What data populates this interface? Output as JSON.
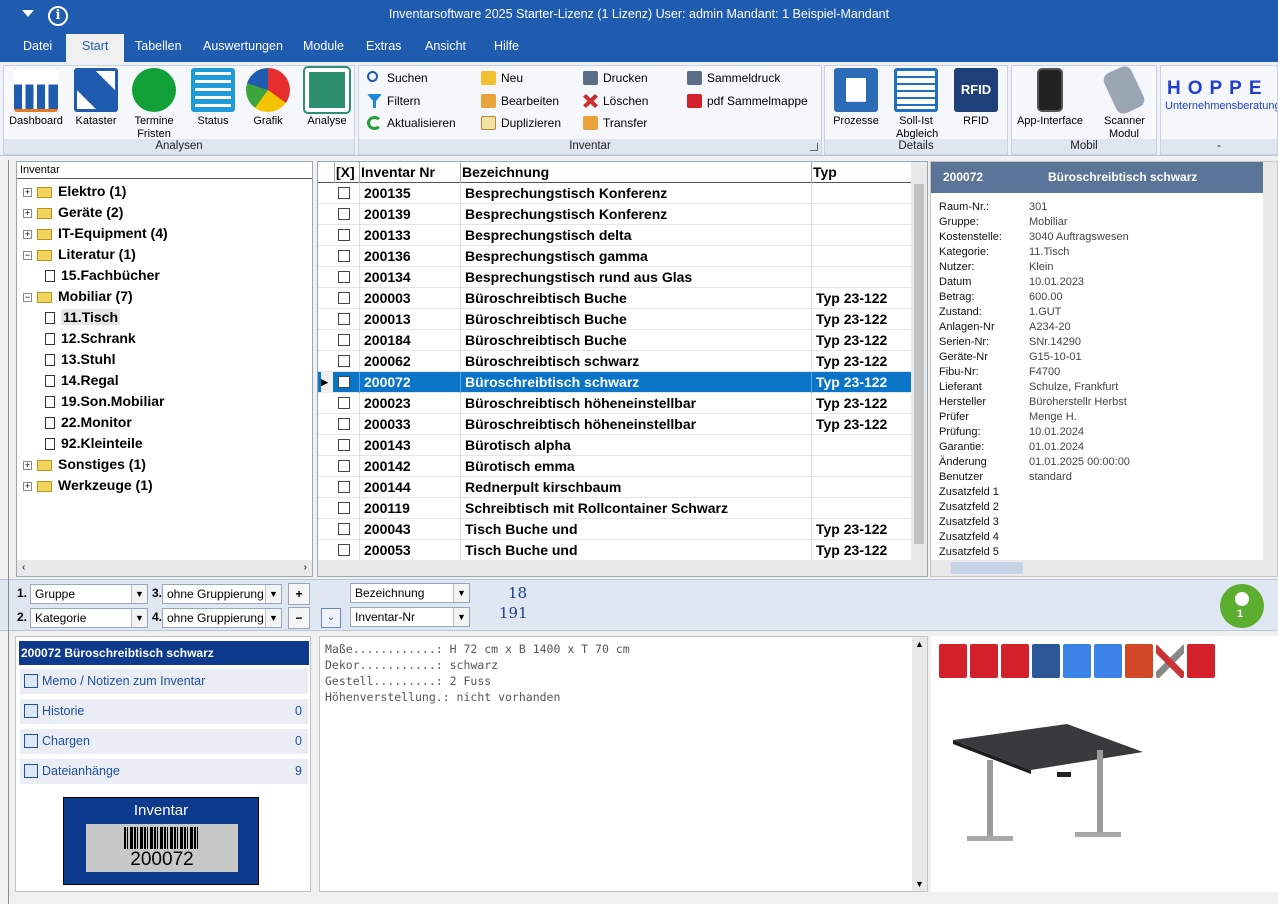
{
  "window": {
    "title": "Inventarsoftware 2025 Starter-Lizenz (1 Lizenz)   User: admin   Mandant: 1 Beispiel-Mandant"
  },
  "menu": [
    "Datei",
    "Start",
    "Tabellen",
    "Auswertungen",
    "Module",
    "Extras",
    "Ansicht",
    "Hilfe"
  ],
  "ribbon": {
    "analysen": {
      "label": "Analysen",
      "buttons": [
        "Dashboard",
        "Kataster",
        "Termine Fristen",
        "Status",
        "Grafik",
        "Analyse"
      ]
    },
    "inventar": {
      "label": "Inventar",
      "col1": [
        "Suchen",
        "Filtern",
        "Aktualisieren"
      ],
      "col2": [
        "Neu",
        "Bearbeiten",
        "Duplizieren"
      ],
      "col3": [
        "Drucken",
        "Löschen",
        "Transfer"
      ],
      "col4": [
        "Sammeldruck",
        "pdf Sammelmappe"
      ]
    },
    "details": {
      "label": "Details",
      "buttons": [
        "Prozesse",
        "Soll-Ist Abgleich",
        "RFID"
      ]
    },
    "mobil": {
      "label": "Mobil",
      "buttons": [
        "App-Interface",
        "Scanner Modul"
      ]
    },
    "extra": {
      "label": "-",
      "logo_line1": "HOPPE",
      "logo_line2": "Unternehmensberatung"
    }
  },
  "tree": {
    "header": "Inventar",
    "items": [
      {
        "label": "Elektro  (1)",
        "level": 0,
        "type": "folder",
        "sign": "+"
      },
      {
        "label": "Geräte  (2)",
        "level": 0,
        "type": "folder",
        "sign": "+"
      },
      {
        "label": "IT-Equipment  (4)",
        "level": 0,
        "type": "folder",
        "sign": "+"
      },
      {
        "label": "Literatur  (1)",
        "level": 0,
        "type": "folder",
        "sign": "−"
      },
      {
        "label": "15.Fachbücher",
        "level": 1,
        "type": "leaf"
      },
      {
        "label": "Mobiliar  (7)",
        "level": 0,
        "type": "folder",
        "sign": "−"
      },
      {
        "label": "11.Tisch",
        "level": 1,
        "type": "leaf",
        "selected": true
      },
      {
        "label": "12.Schrank",
        "level": 1,
        "type": "leaf"
      },
      {
        "label": "13.Stuhl",
        "level": 1,
        "type": "leaf"
      },
      {
        "label": "14.Regal",
        "level": 1,
        "type": "leaf"
      },
      {
        "label": "19.Son.Mobiliar",
        "level": 1,
        "type": "leaf"
      },
      {
        "label": "22.Monitor",
        "level": 1,
        "type": "leaf"
      },
      {
        "label": "92.Kleinteile",
        "level": 1,
        "type": "leaf"
      },
      {
        "label": "Sonstiges  (1)",
        "level": 0,
        "type": "folder",
        "sign": "+"
      },
      {
        "label": "Werkzeuge  (1)",
        "level": 0,
        "type": "folder",
        "sign": "+"
      }
    ]
  },
  "grid": {
    "headers": {
      "check": "[X]",
      "nr": "Inventar Nr",
      "bez": "Bezeichnung",
      "typ": "Typ"
    },
    "rows": [
      {
        "nr": "200135",
        "bez": "Besprechungstisch Konferenz",
        "typ": ""
      },
      {
        "nr": "200139",
        "bez": "Besprechungstisch Konferenz",
        "typ": ""
      },
      {
        "nr": "200133",
        "bez": "Besprechungstisch delta",
        "typ": ""
      },
      {
        "nr": "200136",
        "bez": "Besprechungstisch gamma",
        "typ": ""
      },
      {
        "nr": "200134",
        "bez": "Besprechungstisch rund aus Glas",
        "typ": ""
      },
      {
        "nr": "200003",
        "bez": "Büroschreibtisch  Buche",
        "typ": "Typ 23-122"
      },
      {
        "nr": "200013",
        "bez": "Büroschreibtisch  Buche",
        "typ": "Typ 23-122"
      },
      {
        "nr": "200184",
        "bez": "Büroschreibtisch  Buche",
        "typ": "Typ 23-122"
      },
      {
        "nr": "200062",
        "bez": "Büroschreibtisch  schwarz",
        "typ": "Typ 23-122"
      },
      {
        "nr": "200072",
        "bez": "Büroschreibtisch  schwarz",
        "typ": "Typ 23-122",
        "selected": true
      },
      {
        "nr": "200023",
        "bez": "Büroschreibtisch höheneinstellbar",
        "typ": "Typ 23-122"
      },
      {
        "nr": "200033",
        "bez": "Büroschreibtisch höheneinstellbar",
        "typ": "Typ 23-122"
      },
      {
        "nr": "200143",
        "bez": "Bürotisch alpha",
        "typ": ""
      },
      {
        "nr": "200142",
        "bez": "Bürotisch emma",
        "typ": ""
      },
      {
        "nr": "200144",
        "bez": "Rednerpult kirschbaum",
        "typ": ""
      },
      {
        "nr": "200119",
        "bez": "Schreibtisch mit Rollcontainer Schwarz",
        "typ": ""
      },
      {
        "nr": "200043",
        "bez": "Tisch  Buche  und",
        "typ": "Typ 23-122"
      },
      {
        "nr": "200053",
        "bez": "Tisch  Buche  und",
        "typ": "Typ 23-122"
      }
    ]
  },
  "details": {
    "id": "200072",
    "name": "Büroschreibtisch  schwarz",
    "fields": [
      {
        "k": "Raum-Nr.:",
        "v": "301"
      },
      {
        "k": "Gruppe:",
        "v": "Mobiliar"
      },
      {
        "k": "Kostenstelle:",
        "v": "3040 Auftragswesen"
      },
      {
        "k": "Kategorie:",
        "v": "11.Tisch"
      },
      {
        "k": "Nutzer:",
        "v": "Klein"
      },
      {
        "k": "Datum",
        "v": "10.01.2023"
      },
      {
        "k": "Betrag:",
        "v": "600.00"
      },
      {
        "k": "Zustand:",
        "v": "1.GUT"
      },
      {
        "k": "Anlagen-Nr",
        "v": "A234-20"
      },
      {
        "k": "Serien-Nr:",
        "v": "SNr.14290"
      },
      {
        "k": "Geräte-Nr",
        "v": "G15-10-01"
      },
      {
        "k": "Fibu-Nr:",
        "v": "F4700"
      },
      {
        "k": "Lieferant",
        "v": "Schulze, Frankfurt"
      },
      {
        "k": "Hersteller",
        "v": "Büroherstellr Herbst"
      },
      {
        "k": "Prüfer",
        "v": "Menge H."
      },
      {
        "k": "Prüfung:",
        "v": "10.01.2024"
      },
      {
        "k": "Garantie:",
        "v": "01.01.2024"
      },
      {
        "k": "Änderung",
        "v": "01.01.2025 00:00:00"
      },
      {
        "k": "Benutzer",
        "v": "standard"
      },
      {
        "k": "Zusatzfeld 1",
        "v": ""
      },
      {
        "k": "Zusatzfeld 2",
        "v": ""
      },
      {
        "k": "Zusatzfeld 3",
        "v": ""
      },
      {
        "k": "Zusatzfeld 4",
        "v": ""
      },
      {
        "k": "Zusatzfeld 5",
        "v": ""
      }
    ]
  },
  "grouping": {
    "g1_num": "1.",
    "g1": "Gruppe",
    "g2_num": "2.",
    "g2": "Kategorie",
    "g3_num": "3.",
    "g3": "ohne Gruppierung",
    "g4_num": "4.",
    "g4": "ohne Gruppierung",
    "plus": "+",
    "minus": "−"
  },
  "sorting": {
    "s1": "Bezeichnung",
    "s2": "Inventar-Nr",
    "count1": "18",
    "count2": "191"
  },
  "user_badge": "1",
  "lower": {
    "title": "200072 Büroschreibtisch  schwarz",
    "items": [
      {
        "label": "Memo / Notizen zum Inventar",
        "count": ""
      },
      {
        "label": "Historie",
        "count": "0"
      },
      {
        "label": "Chargen",
        "count": "0"
      },
      {
        "label": "Dateianhänge",
        "count": "9"
      }
    ],
    "barcode": {
      "label": "Inventar",
      "value": "200072"
    }
  },
  "memo": [
    "Maße............: H 72 cm x B 1400 x T 70 cm",
    "Dekor...........: schwarz",
    "Gestell.........: 2 Fuss",
    "Höhenverstellung.: nicht vorhanden"
  ],
  "attachments": {
    "icons": [
      "pdf",
      "pdf",
      "pdf",
      "word",
      "gdoc",
      "gdoc",
      "ppt",
      "tools",
      "pdf"
    ],
    "colors": {
      "pdf": "#d3202a",
      "word": "#2b5797",
      "gdoc": "#3b82e6",
      "ppt": "#d24726"
    }
  }
}
